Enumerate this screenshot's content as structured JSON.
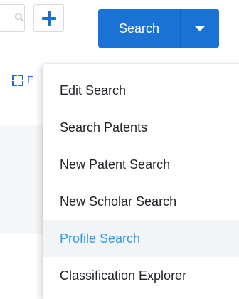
{
  "toolbar": {
    "search_label": "Search",
    "fullscreen_label": "F"
  },
  "menu": {
    "items": [
      {
        "label": "Edit Search"
      },
      {
        "label": "Search Patents"
      },
      {
        "label": "New Patent Search"
      },
      {
        "label": "New Scholar Search"
      },
      {
        "label": "Profile Search",
        "active": true
      },
      {
        "label": "Classification Explorer"
      }
    ]
  },
  "colors": {
    "primary": "#1a73d4",
    "active_text": "#2c9be6",
    "active_bg": "#f3f4f6",
    "menu_text": "#1f2328"
  }
}
